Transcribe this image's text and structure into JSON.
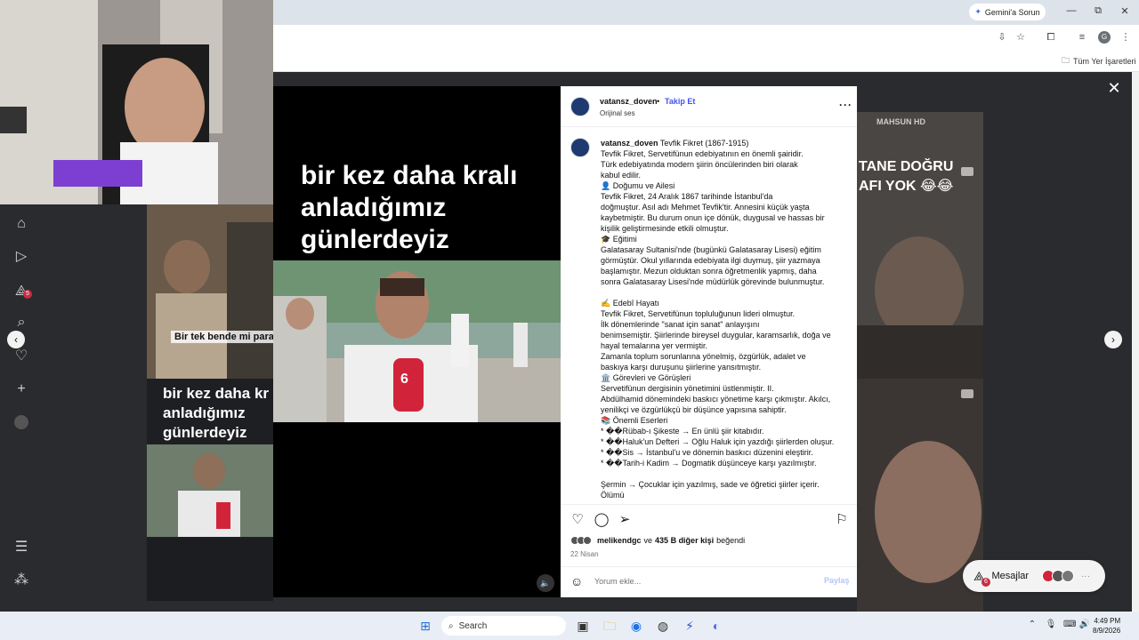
{
  "browser": {
    "gemini_label": "Gemini'a Sorun",
    "bookmarks_folder": "Tüm Yer İşaretleri",
    "profile_initial": "G"
  },
  "feed": {
    "left_thumb_caption": "Bir tek bende mi para y",
    "left_thumb_title": "bir kez daha kr anladığımız günlerdeyiz",
    "right_thumb_caption": "TANE DOĞRU AFI YOK 😂😂",
    "right_thumb_logo": "MAHSUN HD",
    "sidebar_badge": "5"
  },
  "post": {
    "username": "vatansz_doven",
    "follow_label": "Takip Et",
    "audio_label": "Orijinal ses",
    "video_title": "bir kez daha kralı anladığımız günlerdeyiz",
    "video_badge": "6",
    "caption_lines": [
      "Tevfik Fikret, Servetifünun edebiyatının en önemli şairidir.",
      "Türk edebiyatında modern şiirin öncülerinden biri olarak",
      "kabul edilir.",
      "👤 Doğumu ve Ailesi",
      "Tevfik Fikret, 24 Aralık 1867 tarihinde İstanbul'da",
      "doğmuştur. Asıl adı Mehmet Tevfik'tir. Annesini küçük yaşta",
      "kaybetmiştir. Bu durum onun içe dönük, duygusal ve hassas bir",
      "kişilik geliştirmesinde etkili olmuştur.",
      "🎓 Eğitimi",
      "Galatasaray Sultanisi'nde (bugünkü Galatasaray Lisesi) eğitim",
      "görmüştür. Okul yıllarında edebiyata ilgi duymuş, şiir yazmaya",
      "başlamıştır. Mezun olduktan sonra öğretmenlik yapmış, daha",
      "sonra Galatasaray Lisesi'nde müdürlük görevinde bulunmuştur.",
      "",
      "✍️ Edebî Hayatı",
      "Tevfik Fikret, Servetifünun topluluğunun lideri olmuştur.",
      "İlk dönemlerinde \"sanat için sanat\" anlayışını",
      "benimsemiştir. Şiirlerinde bireysel duygular, karamsarlık, doğa ve",
      "hayal temalarına yer vermiştir.",
      "Zamanla toplum sorunlarına yönelmiş, özgürlük, adalet ve",
      "baskıya karşı duruşunu şiirlerine yansıtmıştır.",
      "🏛️ Görevleri ve Görüşleri",
      "Servetifünun dergisinin yönetimini üstlenmiştir. II.",
      "Abdülhamid dönemindeki baskıcı yönetime karşı çıkmıştır. Akılcı,",
      "yenilikçi ve özgürlükçü bir düşünce yapısına sahiptir.",
      "📚 Önemli Eserleri",
      "* ��Rübab-ı Şikeste → En ünlü şiir kitabıdır.",
      "* ��Haluk'un Defteri → Oğlu Haluk için yazdığı şiirlerden oluşur.",
      "* ��Sis → İstanbul'u ve dönemin baskıcı düzenini eleştirir.",
      "* ��Tarih-i Kadim → Dogmatik düşünceye karşı yazılmıştır.",
      "",
      "Şermin → Çocuklar için yazılmış, sade ve öğretici şiirler içerir.",
      "Ölümü"
    ],
    "caption_title": "Tevfik Fikret (1867-1915)",
    "liked_by_user": "melikendgc",
    "liked_by_join": "ve",
    "liked_by_others": "435 B diğer kişi",
    "liked_by_suffix": "beğendi",
    "date": "22 Nisan",
    "comment_placeholder": "Yorum ekle...",
    "post_button": "Paylaş"
  },
  "messages": {
    "label": "Mesajlar",
    "badge": "6"
  },
  "taskbar": {
    "search_label": "Search",
    "time": "4:49 PM",
    "date": "8/9/2026"
  }
}
